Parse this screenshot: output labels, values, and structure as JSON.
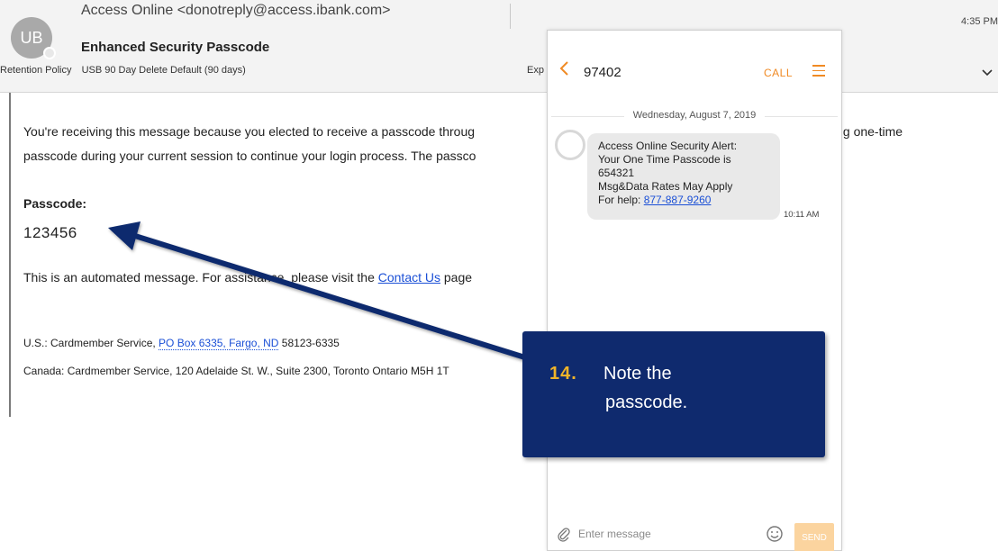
{
  "email": {
    "avatar_initials": "UB",
    "sender": "Access Online <donotreply@access.ibank.com>",
    "subject": "Enhanced Security Passcode",
    "retention_label": "Retention Policy",
    "retention_value": "USB 90 Day Delete Default (90 days)",
    "expires_label": "Exp",
    "time": "4:35 PM",
    "body_line1": "You're receiving this message because you elected to receive a passcode throug",
    "body_line1_tail": "ving one-time",
    "body_line2": "passcode during your current session to continue your login process. The passco",
    "passcode_label": "Passcode:",
    "passcode_value": "123456",
    "auto_msg_before": "This is an automated message. For assistance, please visit the ",
    "auto_msg_link": "Contact Us",
    "auto_msg_after": " page",
    "address_us_prefix": "U.S.: Cardmember Service, ",
    "address_us_link": "PO Box 6335, Fargo, ND",
    "address_us_suffix": " 58123-6335",
    "address_canada": "Canada: Cardmember Service, 120 Adelaide St. W., Suite 2300, Toronto Ontario M5H 1T"
  },
  "phone": {
    "number": "97402",
    "call_label": "CALL",
    "date": "Wednesday, August 7, 2019",
    "message_lines": [
      "Access Online Security Alert:",
      "Your One Time Passcode is",
      "654321",
      "Msg&Data Rates May Apply"
    ],
    "help_prefix": "For help: ",
    "help_number": "877-887-9260",
    "message_time": "10:11 AM",
    "input_placeholder": "Enter message",
    "send_label": "SEND"
  },
  "callout": {
    "step": "14.",
    "line1": "Note the",
    "line2": "passcode."
  },
  "colors": {
    "callout_bg": "#0f2a6e",
    "step_number": "#f0b429",
    "accent_orange": "#f08a24",
    "link_blue": "#1a4fd6"
  },
  "icons": [
    "chevron-down-icon",
    "back-chevron-icon",
    "menu-icon",
    "attach-icon",
    "emoji-icon",
    "presence-icon"
  ]
}
